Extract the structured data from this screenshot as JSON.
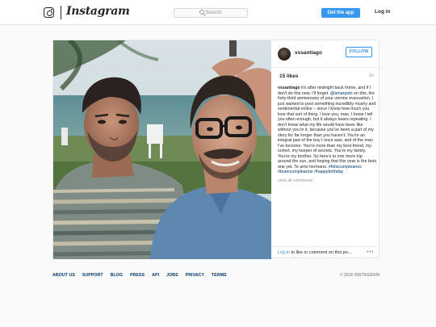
{
  "header": {
    "wordmark": "Instagram",
    "search_placeholder": "Search",
    "get_app_label": "Get the app",
    "login_label": "Log in"
  },
  "post": {
    "username": "vssantiago",
    "follow_label": "FOLLOW",
    "likes": "15 likes",
    "age": "1h",
    "caption": {
      "username": "vssantiago",
      "text_1": " it's after midnight back home, and if I don't do this now, I'll forget. ",
      "mention": "@amarpolo",
      "text_2": " on this, the forty-third anniversary of your uterine evacuation, I just wanted to post something incredibly mushy and sentimental online – since I know how much you love that sort of thing. I love you, man. I know I tell you often enough, but it always bears repeating. I don't know what my life would have been like without you in it, because you've been a part of my story for far longer than you haven't. You're an integral part of the boy I once was, and of the man I've become. You're more than my best friend, my cohort, my keeper of secrets. You're my family. You're my brother. So here's to one more trip around the sun, and hoping that this year is the best one yet. Te amo hermano. ",
      "hashtag_1": "#felizcumpleanos",
      "hashtag_2": "#buencompleanno",
      "hashtag_3": "#happybirthday"
    },
    "view_all": "view all comments",
    "login_link": "Log in",
    "login_rest": " to like or comment on this po...",
    "more_dots": "•••"
  },
  "footer": {
    "links": [
      "ABOUT US",
      "SUPPORT",
      "BLOG",
      "PRESS",
      "API",
      "JOBS",
      "PRIVACY",
      "TERMS"
    ],
    "copyright": "© 2016 INSTAGRAM"
  },
  "colors": {
    "accent": "#3897f0",
    "link": "#003569",
    "muted": "#999999",
    "page_bg": "#fafafa"
  },
  "icons": {
    "logo": "instagram-camera-icon",
    "search": "search-icon",
    "more": "more-options-icon"
  }
}
